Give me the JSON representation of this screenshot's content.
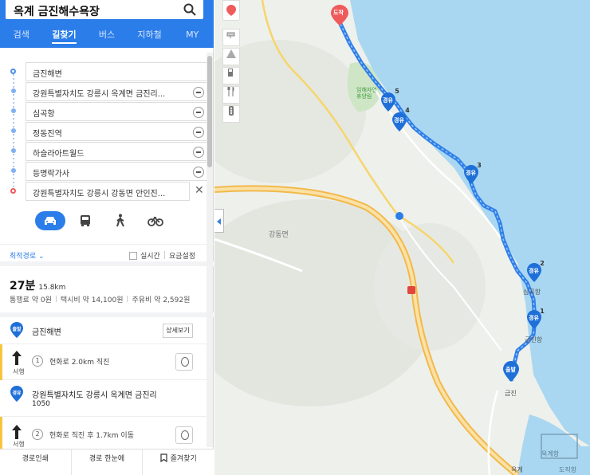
{
  "search": {
    "query": "옥계 금진해수욕장"
  },
  "tabs": [
    "검색",
    "길찾기",
    "버스",
    "지하철",
    "MY"
  ],
  "active_tab": "길찾기",
  "route_points": [
    {
      "label": "금진해변",
      "type": "start"
    },
    {
      "label": "강원특별자치도 강릉시 옥계면 금진리...",
      "type": "via"
    },
    {
      "label": "심곡항",
      "type": "via"
    },
    {
      "label": "정동진역",
      "type": "via"
    },
    {
      "label": "하슬라아트월드",
      "type": "via"
    },
    {
      "label": "등명락가사",
      "type": "via"
    },
    {
      "label": "강원특별자치도 강릉시 강동면 안인진...",
      "type": "end"
    }
  ],
  "modes": [
    "car",
    "bus",
    "walk",
    "bike"
  ],
  "active_mode": "car",
  "sort": {
    "option": "최적경로 ⌄",
    "realtime": "실시간",
    "fare_settings": "요금설정"
  },
  "summary": {
    "duration": "27분",
    "distance": "15.8km",
    "toll": "통행료 약 0원",
    "taxi": "택시비 약 14,100원",
    "fuel": "주유비 약 2,592원"
  },
  "steps": {
    "start": {
      "badge": "출발",
      "title": "금진해변",
      "detail_btn": "상세보기"
    },
    "s1": {
      "num": "1",
      "dir": "서행",
      "text": "헌화로 2.0km 직진"
    },
    "via": {
      "badge": "경유",
      "title": "강원특별자치도 강릉시 옥계면 금진리",
      "sub": "1050"
    },
    "s2": {
      "num": "2",
      "dir": "서행",
      "text": "헌화로 직진 후 1.7km 이동"
    }
  },
  "bottom_bar": {
    "print": "경로인쇄",
    "overview": "경로 한눈에",
    "favorite": "즐겨찾기"
  },
  "map": {
    "labels": {
      "rest": "임해자연\n휴양림",
      "gangdong": "강동면",
      "simgok": "심곡항",
      "geumjin_port": "금진항",
      "geumjin": "금진",
      "okgye_port": "옥계항",
      "okgye": "옥계",
      "docks": "도직항"
    },
    "markers": {
      "arrive": "도착",
      "depart": "출발",
      "via": "경유"
    },
    "route_color": "#2f7fe8",
    "sea_color": "#a9d7f1"
  }
}
